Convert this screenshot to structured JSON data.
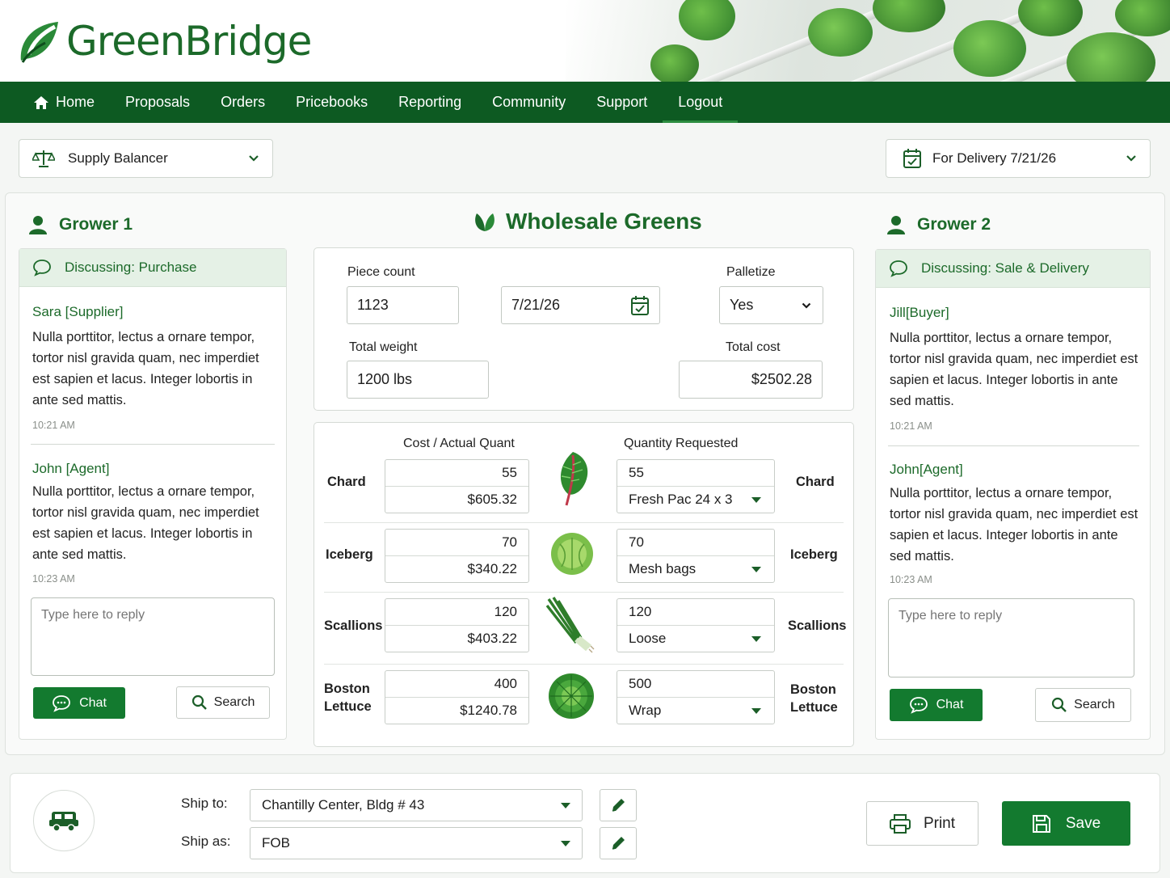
{
  "brand": {
    "name": "GreenBridge",
    "accent": "#1c6a2a",
    "nav_bg": "#0d5a22",
    "button_green": "#137a2f"
  },
  "nav": {
    "items": [
      {
        "label": "Home",
        "icon": "home-icon"
      },
      {
        "label": "Proposals"
      },
      {
        "label": "Orders"
      },
      {
        "label": "Pricebooks"
      },
      {
        "label": "Reporting"
      },
      {
        "label": "Community"
      },
      {
        "label": "Support"
      },
      {
        "label": "Logout"
      }
    ]
  },
  "toolbar": {
    "mode": {
      "value": "Supply Balancer",
      "icon": "scale-icon"
    },
    "delivery": {
      "value": "For Delivery 7/21/26",
      "icon": "calendar-icon"
    }
  },
  "grower1": {
    "title": "Grower 1",
    "discussing": "Discussing: Purchase",
    "messages": [
      {
        "name": "Sara [Supplier]",
        "body": "Nulla porttitor, lectus a ornare tempor, tortor nisl gravida quam, nec imperdiet est sapien et lacus. Integer lobortis in ante sed mattis.",
        "time": "10:21 AM"
      },
      {
        "name": "John [Agent]",
        "body": "Nulla porttitor, lectus a ornare tempor, tortor nisl gravida quam, nec imperdiet est sapien et lacus. Integer lobortis in ante sed mattis.",
        "time": "10:23 AM"
      }
    ],
    "reply_placeholder": "Type here to reply",
    "chat_label": "Chat",
    "search_label": "Search"
  },
  "grower2": {
    "title": "Grower 2",
    "discussing": "Discussing: Sale & Delivery",
    "messages": [
      {
        "name": "Jill[Buyer]",
        "body": "Nulla porttitor, lectus a ornare tempor, tortor nisl gravida quam, nec imperdiet est sapien et lacus. Integer lobortis in ante sed mattis.",
        "time": "10:21 AM"
      },
      {
        "name": "John[Agent]",
        "body": "Nulla porttitor, lectus a ornare tempor, tortor nisl gravida quam, nec imperdiet est sapien et lacus. Integer lobortis in ante sed mattis.",
        "time": "10:23 AM"
      }
    ],
    "reply_placeholder": "Type here to reply",
    "chat_label": "Chat",
    "search_label": "Search"
  },
  "center": {
    "title": "Wholesale Greens",
    "piece_count_label": "Piece count",
    "piece_count": "1123",
    "date": "7/21/26",
    "palletize_label": "Palletize",
    "palletize": "Yes",
    "total_weight_label": "Total weight",
    "total_weight": "1200 lbs",
    "total_cost_label": "Total cost",
    "total_cost": "$2502.28",
    "col_left": "Cost / Actual Quant",
    "col_right": "Quantity Requested",
    "items": [
      {
        "name": "Chard",
        "actual": "55",
        "cost": "$605.32",
        "requested": "55",
        "pack": "Fresh Pac 24 x 3",
        "icon": "chard-icon"
      },
      {
        "name": "Iceberg",
        "actual": "70",
        "cost": "$340.22",
        "requested": "70",
        "pack": "Mesh bags",
        "icon": "iceberg-icon"
      },
      {
        "name": "Scallions",
        "actual": "120",
        "cost": "$403.22",
        "requested": "120",
        "pack": "Loose",
        "icon": "scallions-icon"
      },
      {
        "name": "Boston\nLettuce",
        "actual": "400",
        "cost": "$1240.78",
        "requested": "500",
        "pack": "Wrap",
        "icon": "boston-lettuce-icon"
      }
    ]
  },
  "shipping": {
    "ship_to_label": "Ship to:",
    "ship_to": "Chantilly Center, Bldg # 43",
    "ship_as_label": "Ship as:",
    "ship_as": "FOB",
    "print_label": "Print",
    "save_label": "Save"
  }
}
